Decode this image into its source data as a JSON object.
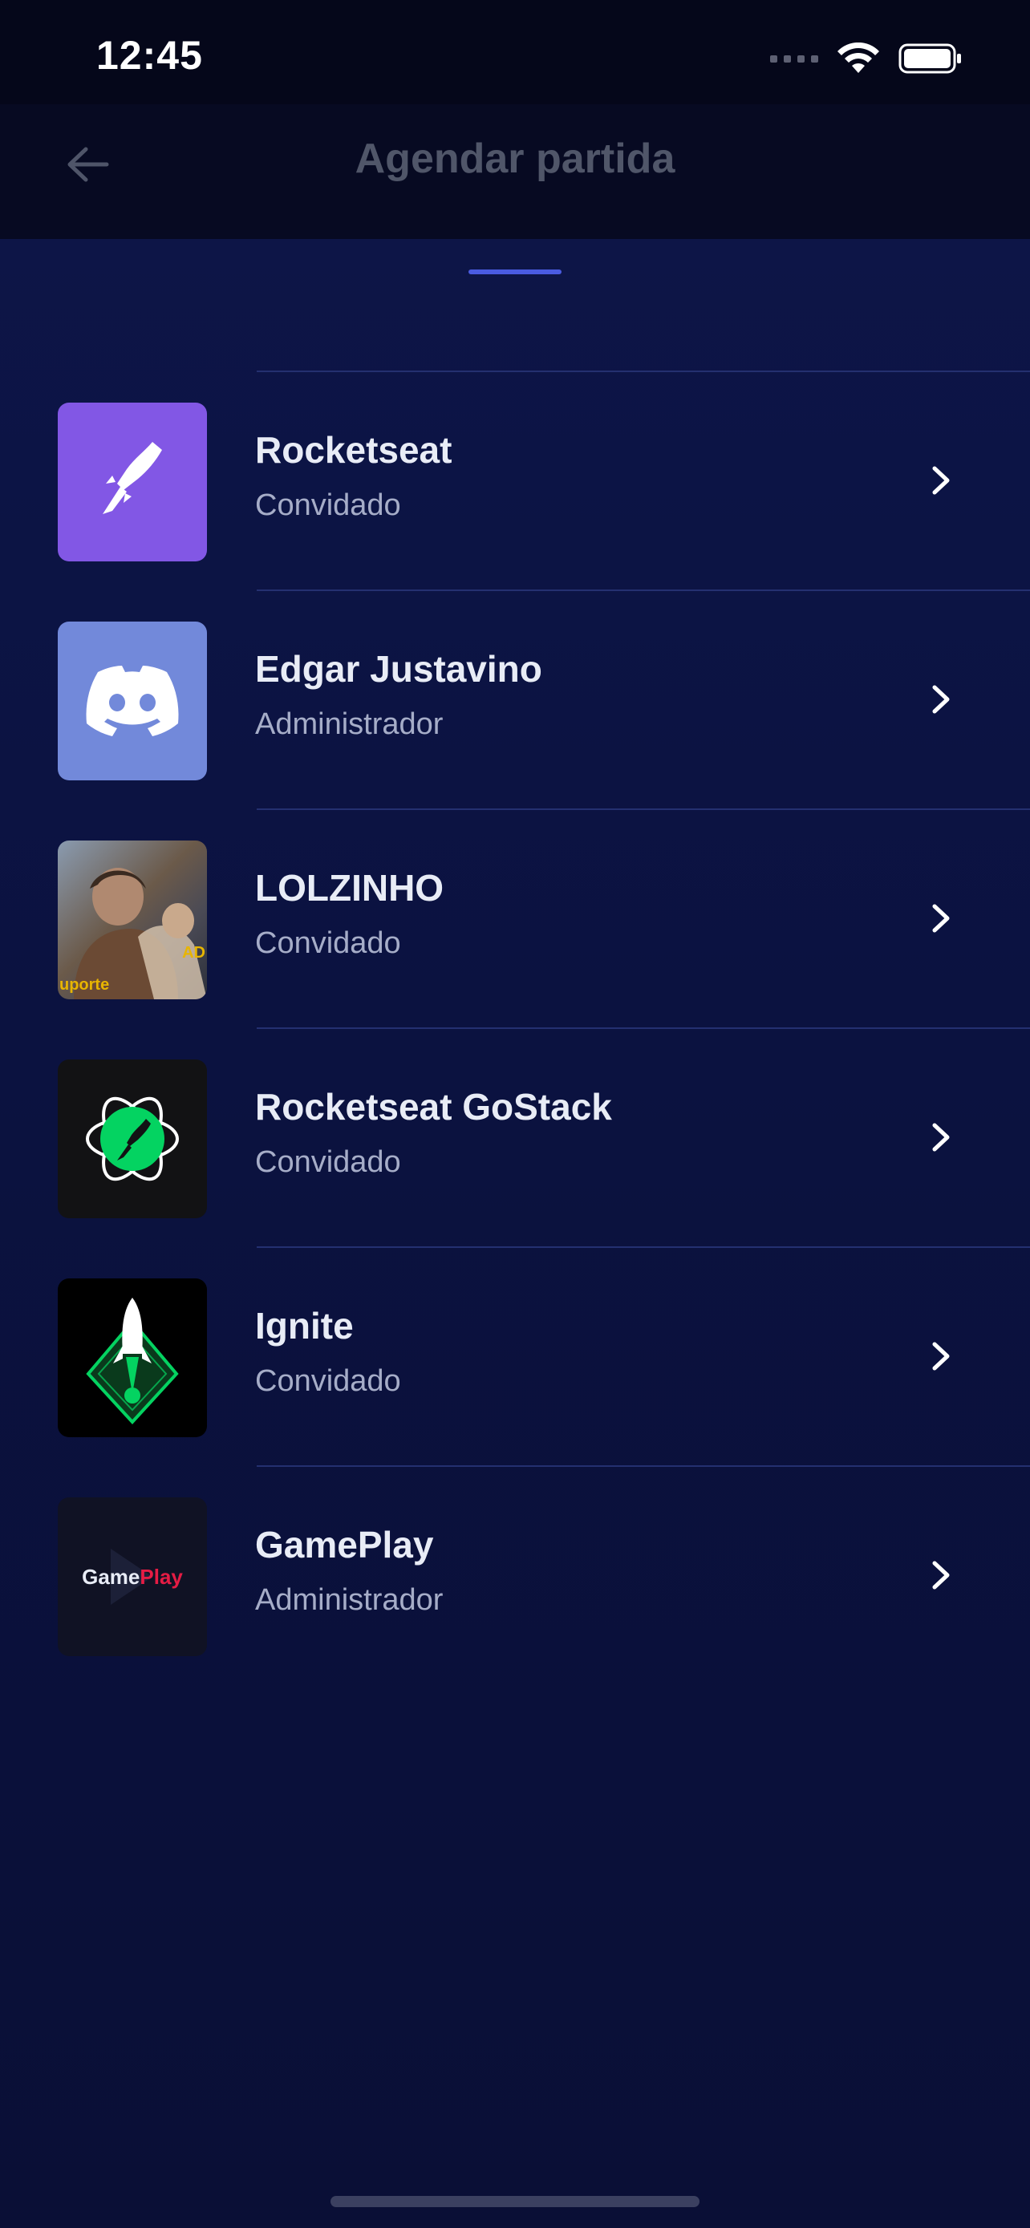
{
  "status_bar": {
    "time": "12:45"
  },
  "header": {
    "title": "Agendar partida",
    "back_icon": "arrow-left-icon"
  },
  "colors": {
    "accent": "#4a5be0",
    "background": "#0a0f33",
    "rocketseat": "#8257e5",
    "discord": "#7289da",
    "gostack": "#04d361"
  },
  "servers": [
    {
      "name": "Rocketseat",
      "role": "Convidado",
      "icon": "rocketseat-logo"
    },
    {
      "name": "Edgar Justavino",
      "role": "Administrador",
      "icon": "discord-logo"
    },
    {
      "name": "LOLZINHO",
      "role": "Convidado",
      "icon": "game-art-image",
      "image_text_left": "uporte",
      "image_text_right": "AD"
    },
    {
      "name": "Rocketseat GoStack",
      "role": "Convidado",
      "icon": "gostack-logo"
    },
    {
      "name": "Ignite",
      "role": "Convidado",
      "icon": "ignite-logo"
    },
    {
      "name": "GamePlay",
      "role": "Administrador",
      "icon": "gameplay-logo",
      "logo_text_a": "Game",
      "logo_text_b": "Play"
    }
  ]
}
